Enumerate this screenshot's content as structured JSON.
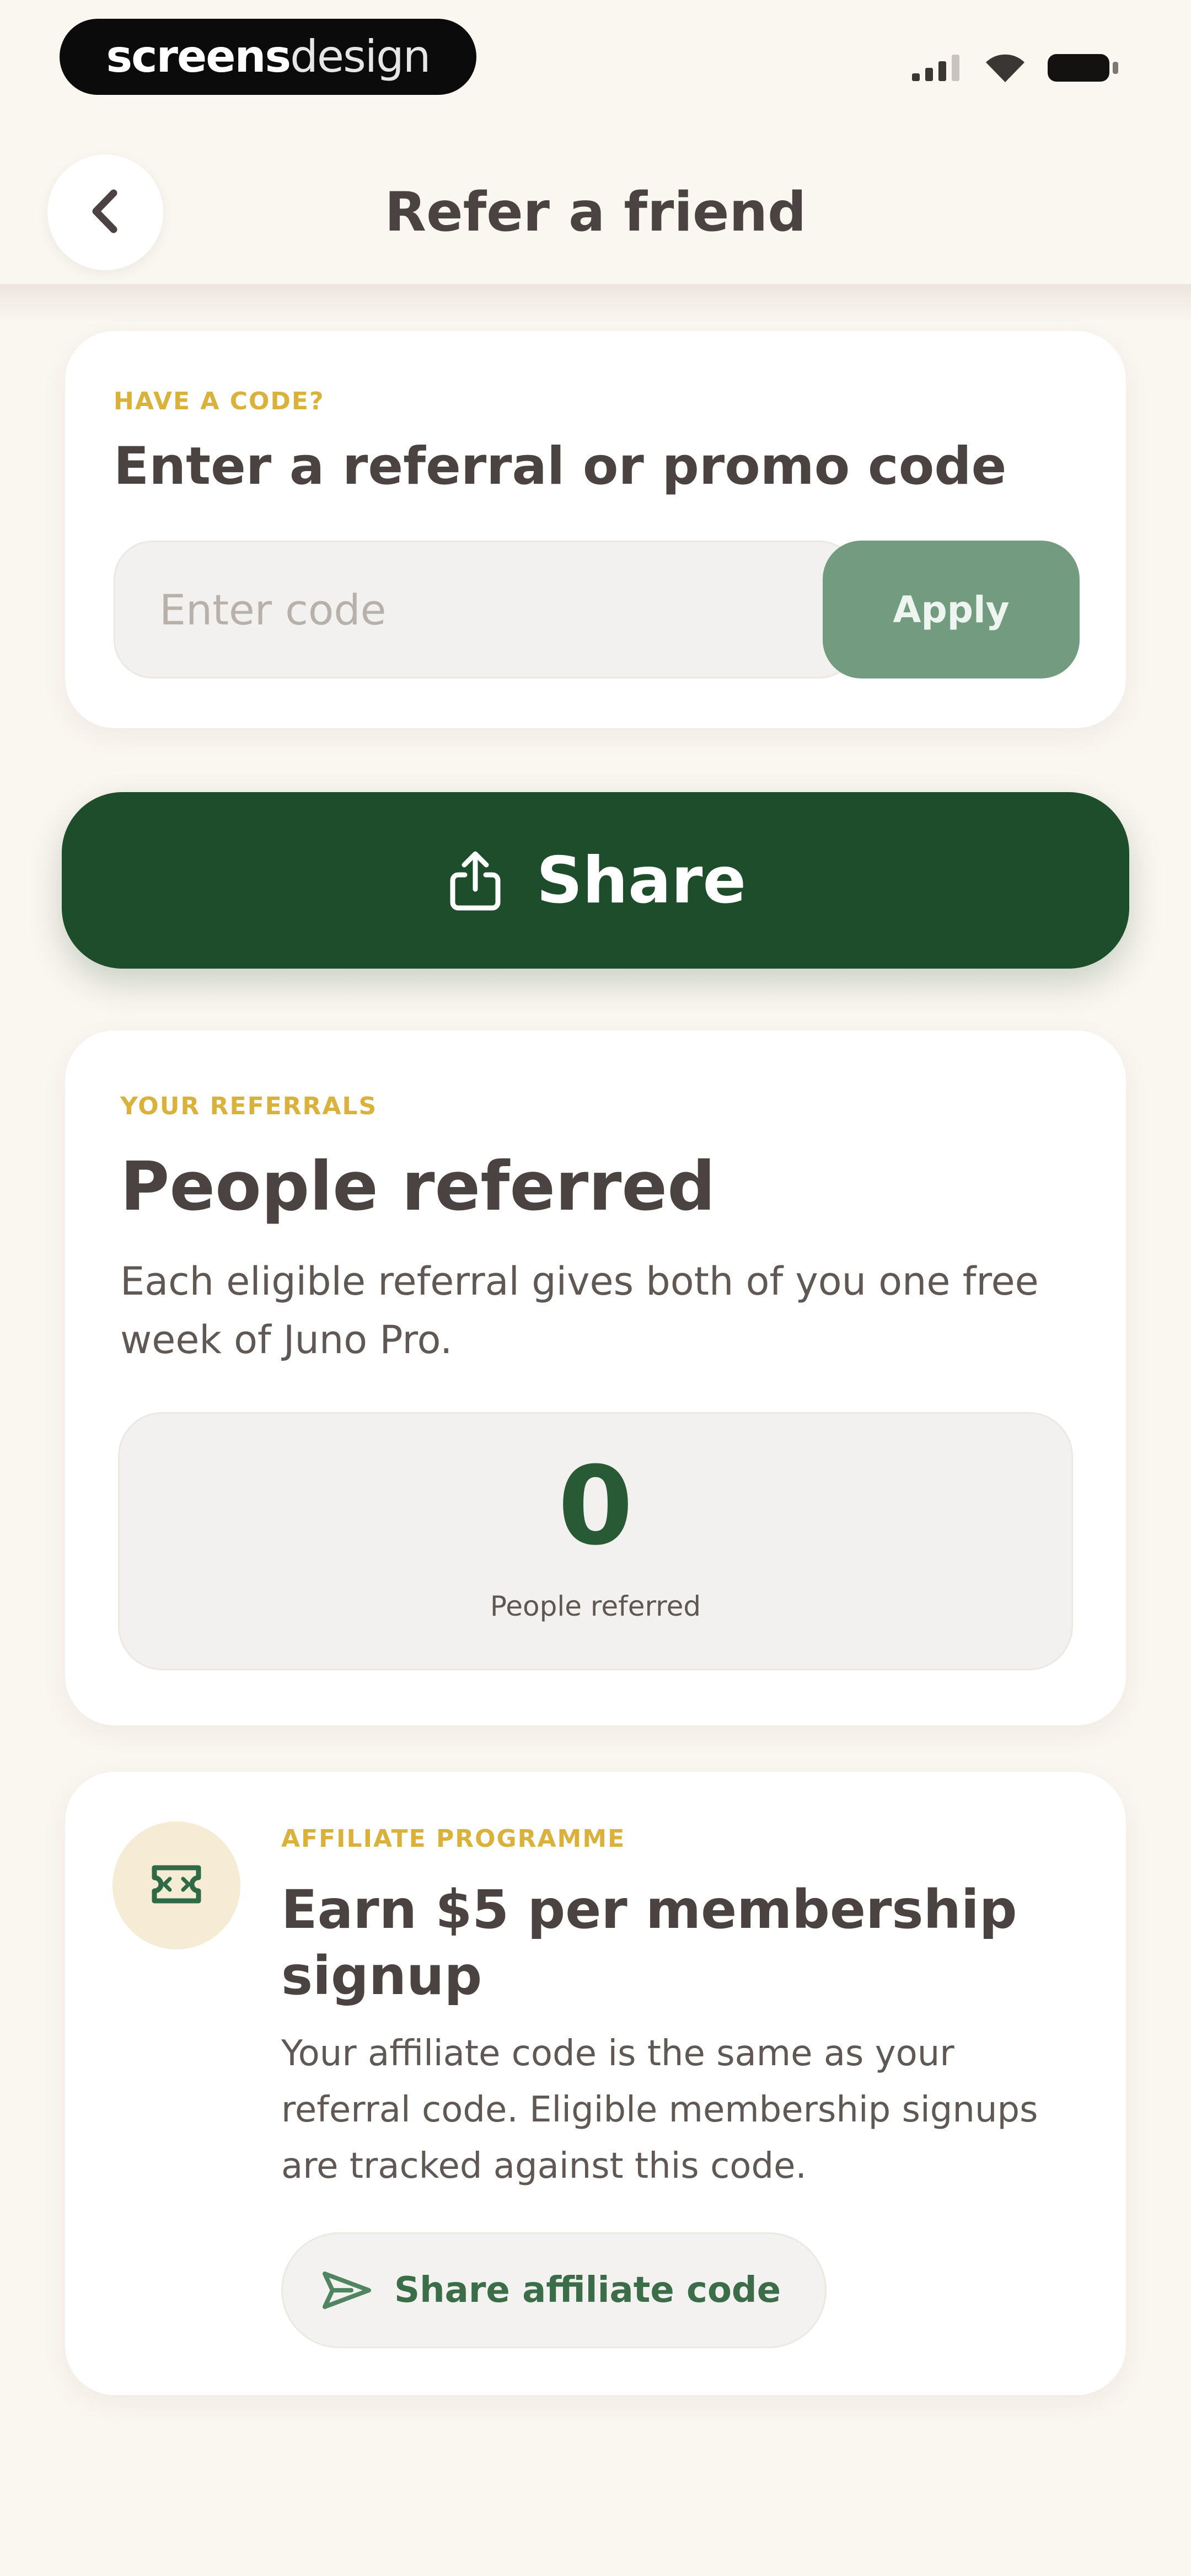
{
  "status_bar": {
    "brand_bold": "screens",
    "brand_light": "design",
    "icons": [
      "signal-icon",
      "wifi-icon",
      "battery-icon"
    ]
  },
  "header": {
    "title": "Refer a friend",
    "back_icon": "chevron-left-icon"
  },
  "code_card": {
    "eyebrow": "Have a code?",
    "heading": "Enter a referral or promo code",
    "input_value": "",
    "input_placeholder": "Enter code",
    "apply_label": "Apply"
  },
  "share": {
    "icon": "share-icon",
    "label": "Share"
  },
  "referrals": {
    "eyebrow": "Your referrals",
    "heading": "People referred",
    "description": "Each eligible referral gives both of you one free week of Juno Pro.",
    "count": "0",
    "count_label": "People referred"
  },
  "affiliate": {
    "icon": "ticket-icon",
    "eyebrow": "Affiliate programme",
    "heading": "Earn $5 per membership signup",
    "description": "Your affiliate code is the same as your referral code. Eligible membership signups are tracked against this code.",
    "button_icon": "send-icon",
    "button_label": "Share affiliate code"
  },
  "colors": {
    "background": "#faf6f0",
    "primary_green": "#1e4d2b",
    "muted_green": "#739b80",
    "accent_gold": "#d9b13b",
    "card": "#ffffff",
    "text": "#4b4341"
  }
}
